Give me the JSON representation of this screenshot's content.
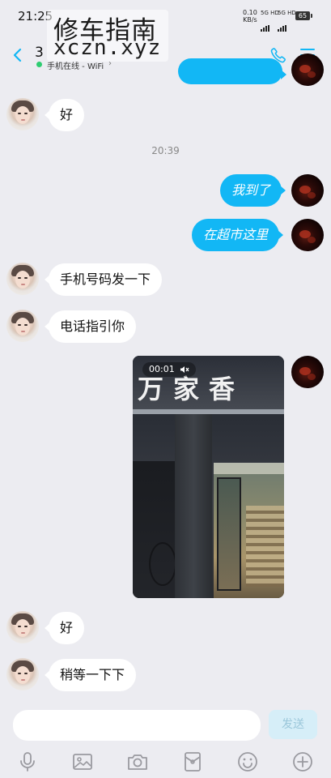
{
  "status_bar": {
    "time": "21:25",
    "net_speed": "0.10",
    "net_unit": "KB/s",
    "sig1": "5G HD",
    "sig2": "5G HD",
    "battery": "65"
  },
  "watermark": {
    "line1": "修车指南",
    "line2": "xczn.xyz"
  },
  "header": {
    "title": "3",
    "status_text": "手机在线 - WiFi",
    "status_arrow": "›",
    "accent_color": "#12b7f5",
    "online_color": "#2ecc71"
  },
  "messages": [
    {
      "side": "in",
      "text": "好"
    },
    {
      "side": "time",
      "text": "20:39"
    },
    {
      "side": "out",
      "text": "我到了"
    },
    {
      "side": "out",
      "text": "在超市这里"
    },
    {
      "side": "in",
      "text": "手机号码发一下"
    },
    {
      "side": "in",
      "text": "电话指引你"
    },
    {
      "side": "out",
      "type": "video",
      "duration": "00:01",
      "sign_text": "万家香"
    },
    {
      "side": "in",
      "text": "好"
    },
    {
      "side": "in",
      "text": "稍等一下下"
    }
  ],
  "composer": {
    "input_value": "",
    "send_label": "发送"
  },
  "toolbar": {
    "icons": [
      "microphone-icon",
      "image-icon",
      "camera-icon",
      "red-packet-icon",
      "emoji-icon",
      "plus-icon"
    ]
  }
}
